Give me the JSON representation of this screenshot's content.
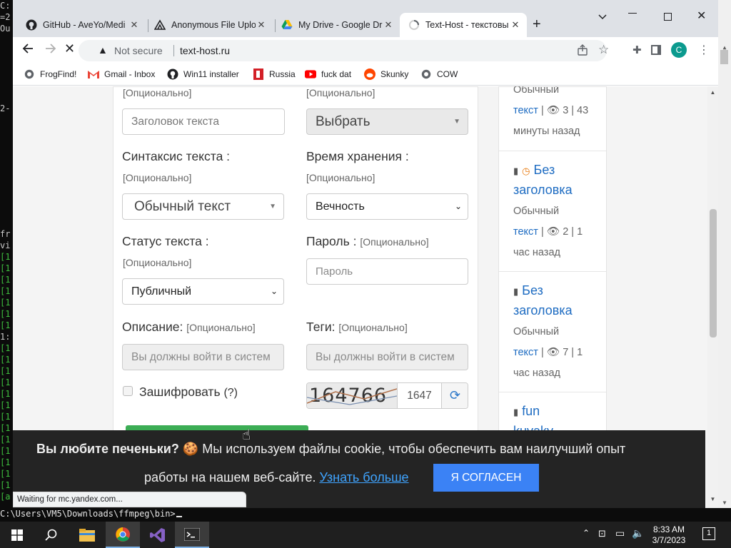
{
  "terminal": {
    "edge_lines": [
      "C:",
      "=2",
      "Ou",
      "",
      "",
      "",
      "",
      "",
      "",
      "2-",
      "",
      "",
      "",
      "",
      "",
      "",
      "",
      "",
      "",
      "",
      "fr",
      "vi",
      "[1",
      "[1",
      "[1",
      "[1",
      "[1",
      "[1",
      "[1",
      "1:",
      "[1",
      "[1",
      "[1",
      "[1",
      "[1",
      "[1",
      "[1",
      "[1",
      "[1",
      "[1",
      "[1",
      "[1",
      "[1",
      "[a"
    ],
    "prompt": "C:\\Users\\VM5\\Downloads\\ffmpeg\\bin>"
  },
  "browser": {
    "tabs": [
      {
        "title": "GitHub - AveYo/Medi",
        "icon": "github-icon"
      },
      {
        "title": "Anonymous File Uplo",
        "icon": "upload-icon"
      },
      {
        "title": "My Drive - Google Dr",
        "icon": "google-drive-icon"
      },
      {
        "title": "Text-Host - текстовы",
        "icon": "loading-icon"
      }
    ],
    "new_tab": "+",
    "address": {
      "security": "Not secure",
      "url": "text-host.ru"
    },
    "profile_initial": "C",
    "bookmarks": [
      {
        "label": "FrogFind!",
        "icon": "globe-icon"
      },
      {
        "label": "Gmail - Inbox",
        "icon": "gmail-icon"
      },
      {
        "label": "Win11 installer",
        "icon": "github-icon"
      },
      {
        "label": "Russia",
        "icon": "flag-icon"
      },
      {
        "label": "fuck dat",
        "icon": "youtube-icon"
      },
      {
        "label": "Skunky",
        "icon": "reddit-icon"
      },
      {
        "label": "COW",
        "icon": "globe-icon"
      }
    ],
    "status": "Waiting for mc.yandex.com..."
  },
  "form": {
    "optional": "[Опционально]",
    "title_placeholder": "Заголовок текста",
    "category_select": "Выбрать",
    "syntax_label": "Синтаксис текста :",
    "syntax_select": "Обычный текст",
    "expiry_label": "Время хранения :",
    "expiry_select": "Вечность",
    "status_label": "Статус текста :",
    "status_select": "Публичный",
    "password_label": "Пароль :",
    "password_placeholder": "Пароль",
    "description_label": "Описание:",
    "description_placeholder": "Вы должны войти в систем",
    "tags_label": "Теги:",
    "tags_placeholder": "Вы должны войти в систем",
    "encrypt_label": "Зашифровать",
    "encrypt_help": "(?)",
    "captcha_image_text": "164766",
    "captcha_value": "1647"
  },
  "sidebar": {
    "top_partial": {
      "meta1": "Обычный",
      "meta2_link": "текст",
      "meta2_rest": " | 👁 3 | 43",
      "meta3": "минуты назад"
    },
    "items": [
      {
        "title1": "Без",
        "title2": "заголовка",
        "meta1": "Обычный",
        "meta2_link": "текст",
        "meta2_rest": " | 👁 2 | 1",
        "meta3": "час назад"
      },
      {
        "title1": "Без",
        "title2": "заголовка",
        "meta1": "Обычный",
        "meta2_link": "текст",
        "meta2_rest": " | 👁 7 | 1",
        "meta3": "час назад"
      },
      {
        "title1": "fun",
        "title2": "kuvaky"
      }
    ]
  },
  "cookie": {
    "question": "Вы любите печеньки?",
    "emoji": "🍪",
    "line1_rest": " Мы используем файлы cookie, чтобы обеспечить вам наилучший опыт",
    "line2": "работы на нашем веб-сайте. ",
    "learn_more": "Узнать больше",
    "accept": "Я СОГЛАСЕН"
  },
  "taskbar": {
    "time": "8:33 AM",
    "date": "3/7/2023",
    "notifications": "1"
  },
  "colors": {
    "accent": "#3b82f5",
    "link": "#1e6cc2",
    "banner": "#242424",
    "submit": "#3cad55"
  }
}
